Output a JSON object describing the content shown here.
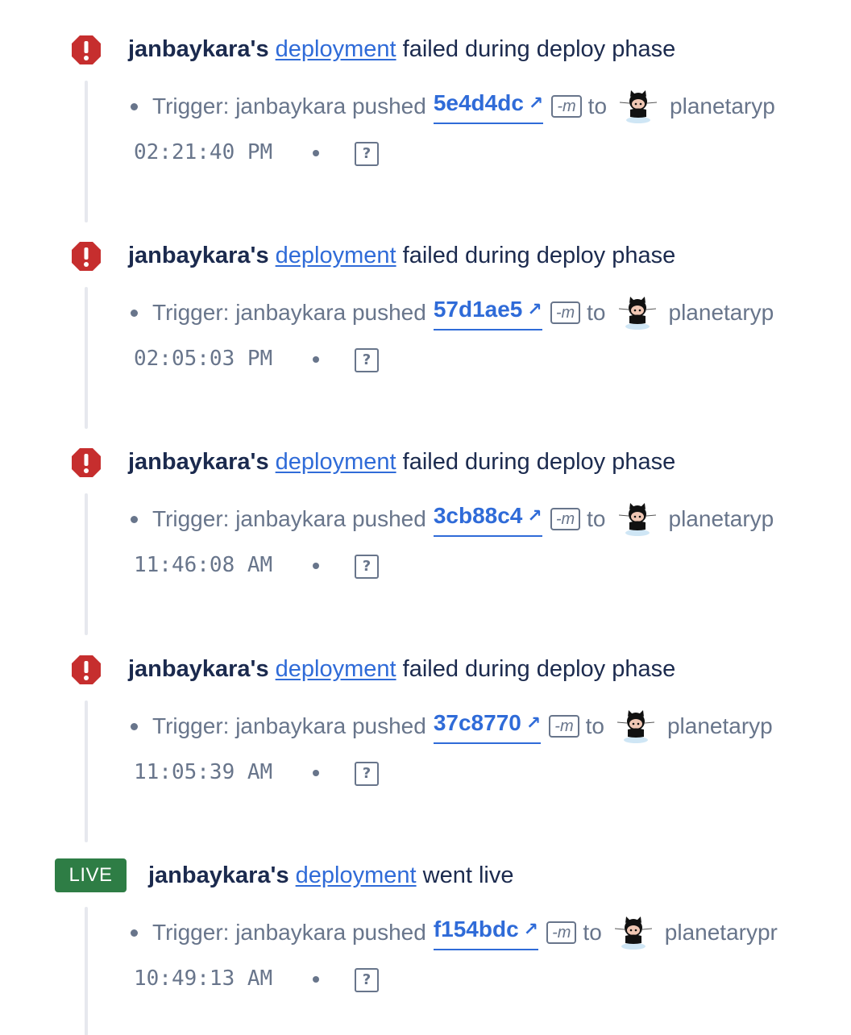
{
  "entries": [
    {
      "status": "failed",
      "actor": "janbaykara's",
      "link": "deployment",
      "message": "failed during deploy phase",
      "trigger_label": "Trigger: janbaykara pushed",
      "commit": "5e4d4dc",
      "flag": "-m",
      "to": "to",
      "repo": "planetaryp",
      "time": "02:21:40 PM",
      "help": "?"
    },
    {
      "status": "failed",
      "actor": "janbaykara's",
      "link": "deployment",
      "message": "failed during deploy phase",
      "trigger_label": "Trigger: janbaykara pushed",
      "commit": "57d1ae5",
      "flag": "-m",
      "to": "to",
      "repo": "planetaryp",
      "time": "02:05:03 PM",
      "help": "?"
    },
    {
      "status": "failed",
      "actor": "janbaykara's",
      "link": "deployment",
      "message": "failed during deploy phase",
      "trigger_label": "Trigger: janbaykara pushed",
      "commit": "3cb88c4",
      "flag": "-m",
      "to": "to",
      "repo": "planetaryp",
      "time": "11:46:08 AM",
      "help": "?"
    },
    {
      "status": "failed",
      "actor": "janbaykara's",
      "link": "deployment",
      "message": "failed during deploy phase",
      "trigger_label": "Trigger: janbaykara pushed",
      "commit": "37c8770",
      "flag": "-m",
      "to": "to",
      "repo": "planetaryp",
      "time": "11:05:39 AM",
      "help": "?"
    },
    {
      "status": "live",
      "badge": "LIVE",
      "actor": "janbaykara's",
      "link": "deployment",
      "message": "went live",
      "trigger_label": "Trigger: janbaykara pushed",
      "commit": "f154bdc",
      "flag": "-m",
      "to": "to",
      "repo": "planetarypr",
      "time": "10:49:13 AM",
      "help": "?"
    }
  ],
  "icons": {
    "error": "error-octagon-icon",
    "arrow": "external-link-arrow-icon",
    "octocat": "github-octocat-icon"
  },
  "colors": {
    "error": "#c62e2e",
    "live": "#2e7d45",
    "link": "#2f6bd8",
    "muted": "#68758b",
    "text": "#1b2a4e"
  }
}
